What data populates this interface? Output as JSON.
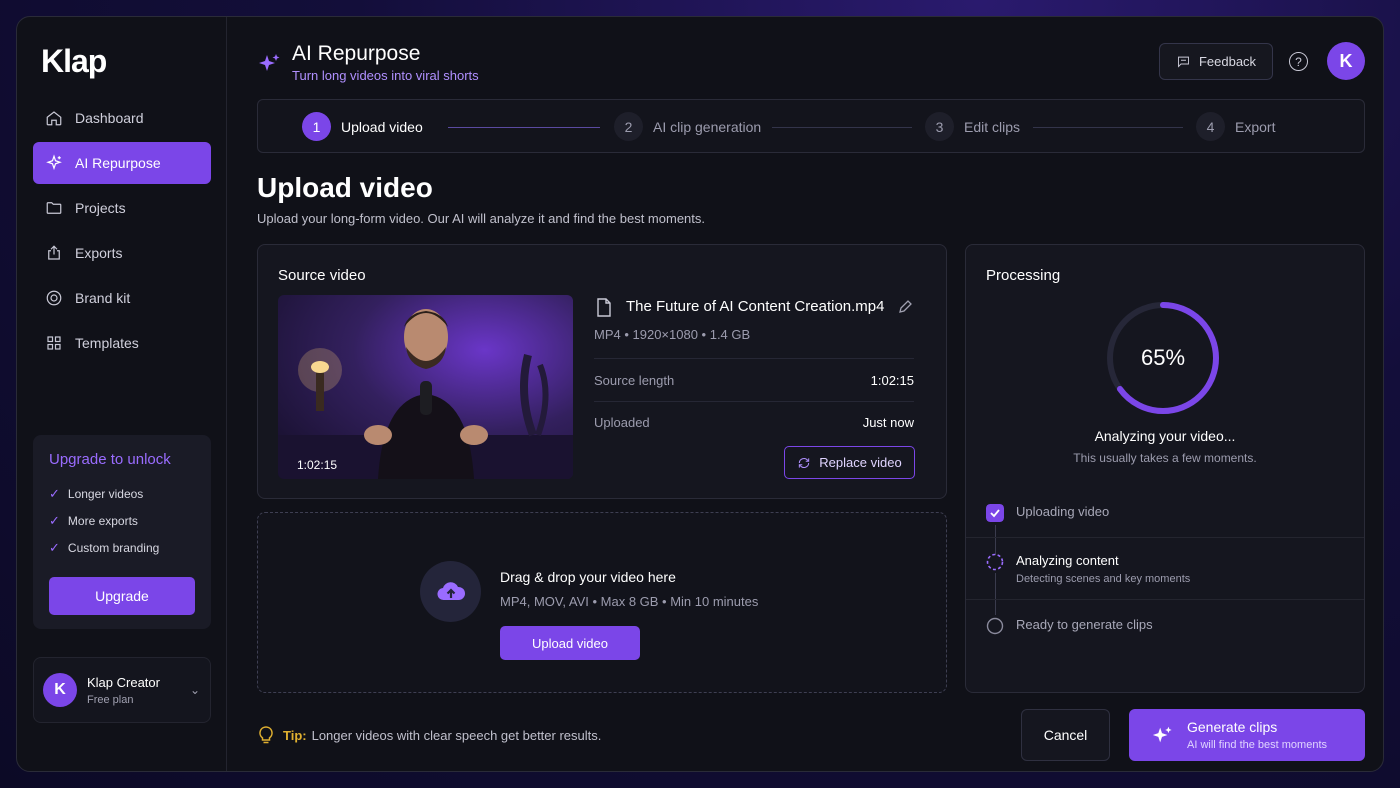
{
  "brand": {
    "logo": "Klap",
    "accent": "#7b46e8"
  },
  "sidebar": {
    "items": [
      {
        "label": "Dashboard",
        "icon": "home-icon"
      },
      {
        "label": "AI Repurpose",
        "icon": "sparkle-icon",
        "active": true
      },
      {
        "label": "Projects",
        "icon": "folder-icon"
      },
      {
        "label": "Exports",
        "icon": "export-icon"
      },
      {
        "label": "Brand kit",
        "icon": "palette-icon"
      },
      {
        "label": "Templates",
        "icon": "grid-icon"
      }
    ],
    "upgrade": {
      "title": "Upgrade to unlock",
      "features": [
        "Longer videos",
        "More exports",
        "Custom branding"
      ],
      "button": "Upgrade"
    },
    "user": {
      "initial": "K",
      "name": "Klap Creator",
      "plan": "Free plan"
    }
  },
  "header": {
    "title": "AI Repurpose",
    "subtitle": "Turn long videos into viral shorts",
    "feedback": "Feedback",
    "help": "?",
    "avatar_initial": "K"
  },
  "stepper": {
    "steps": [
      {
        "num": "1",
        "label": "Upload video",
        "active": true
      },
      {
        "num": "2",
        "label": "AI clip generation"
      },
      {
        "num": "3",
        "label": "Edit clips"
      },
      {
        "num": "4",
        "label": "Export"
      }
    ]
  },
  "page": {
    "title": "Upload video",
    "description": "Upload your long-form video. Our AI will analyze it and find the best moments."
  },
  "source": {
    "title": "Source video",
    "thumb_duration": "1:02:15",
    "file_name": "The Future of AI Content Creation.mp4",
    "file_meta": "MP4 • 1920×1080 • 1.4 GB",
    "length_label": "Source length",
    "length_value": "1:02:15",
    "uploaded_label": "Uploaded",
    "uploaded_value": "Just now",
    "replace": "Replace video"
  },
  "dropzone": {
    "title": "Drag & drop your video here",
    "subtitle": "MP4, MOV, AVI • Max 8 GB • Min 10 minutes",
    "button": "Upload video"
  },
  "processing": {
    "title": "Processing",
    "progress": 65,
    "progress_label": "65%",
    "status": "Analyzing your video...",
    "status_sub": "This usually takes a few moments.",
    "tasks": [
      {
        "label": "Uploading video",
        "state": "done"
      },
      {
        "label": "Analyzing content",
        "sub": "Detecting scenes and key moments",
        "state": "active"
      },
      {
        "label": "Ready to generate clips",
        "state": "pending"
      }
    ]
  },
  "footer": {
    "tip_key": "Tip:",
    "tip_text": "Longer videos with clear speech get better results.",
    "cancel": "Cancel",
    "generate_title": "Generate clips",
    "generate_sub": "AI will find the best moments"
  }
}
